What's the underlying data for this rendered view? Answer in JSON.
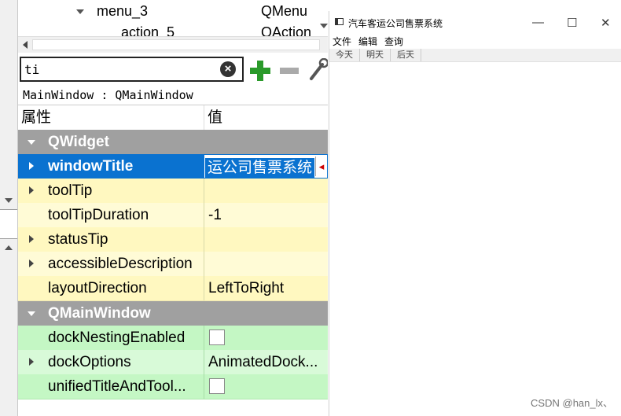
{
  "tree": {
    "rows": [
      {
        "name": "menu_3",
        "class": "QMenu"
      },
      {
        "name": "action_5",
        "class": "QAction"
      }
    ]
  },
  "filter": {
    "value": "ti",
    "clear_icon": "clear-icon"
  },
  "toolbar": {
    "icons": [
      "add-icon",
      "remove-icon",
      "wrench-icon"
    ]
  },
  "object_line": "MainWindow : QMainWindow",
  "table": {
    "headers": {
      "property": "属性",
      "value": "值"
    },
    "rows": [
      {
        "name": "QWidget",
        "value": "",
        "kind": "group"
      },
      {
        "name": "windowTitle",
        "value": "运公司售票系统",
        "kind": "selected"
      },
      {
        "name": "toolTip",
        "value": "",
        "kind": "yellow"
      },
      {
        "name": "toolTipDuration",
        "value": "-1",
        "kind": "yellow"
      },
      {
        "name": "statusTip",
        "value": "",
        "kind": "yellow"
      },
      {
        "name": "accessibleDescription",
        "value": "",
        "kind": "yellow"
      },
      {
        "name": "layoutDirection",
        "value": "LeftToRight",
        "kind": "yellow"
      },
      {
        "name": "QMainWindow",
        "value": "",
        "kind": "group"
      },
      {
        "name": "dockNestingEnabled",
        "value": "",
        "kind": "green"
      },
      {
        "name": "dockOptions",
        "value": "AnimatedDock...",
        "kind": "green"
      },
      {
        "name": "unifiedTitleAndTool...",
        "value": "",
        "kind": "green"
      }
    ]
  },
  "preview": {
    "title": "汽车客运公司售票系统",
    "controls": {
      "minimize": "—",
      "maximize": "☐",
      "close": "✕"
    },
    "menu": [
      "文件",
      "编辑",
      "查询"
    ],
    "tabs": [
      "今天",
      "明天",
      "后天"
    ]
  },
  "watermark": "CSDN @han_lx、",
  "colors": {
    "selected": "#0a72d0",
    "group": "#a0a0a0",
    "yellow": "#fff8c0",
    "green": "#c4f7c4"
  }
}
